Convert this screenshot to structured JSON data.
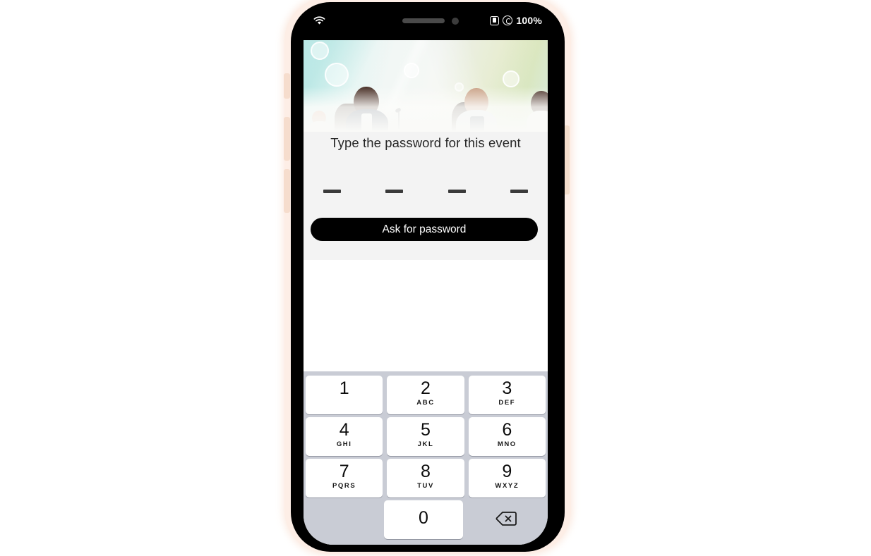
{
  "device": {
    "type": "smartphone-mockup",
    "frame_color": "#000000",
    "rim_color": "#fdeee6"
  },
  "statusbar": {
    "wifi_icon": "wifi-icon",
    "alarm_icon": "alarm-icon",
    "orientation_lock_icon": "orientation-lock-icon",
    "battery_percent": "100%"
  },
  "banner": {
    "alt": "conference-audience-banner",
    "gradient_from": "#96e2de",
    "gradient_to": "#dfe5a7"
  },
  "panel": {
    "title": "Type the password for this event",
    "password_length": 4,
    "password_dashes": [
      "—",
      "—",
      "—",
      "—"
    ],
    "ask_button_label": "Ask for password",
    "ask_button_color": "#000000",
    "background": "#f3f3f3"
  },
  "keypad": {
    "background": "#c9ccd5",
    "key_background": "#ffffff",
    "delete_icon": "backspace-icon",
    "rows": [
      [
        {
          "digit": "1",
          "letters": ""
        },
        {
          "digit": "2",
          "letters": "ABC"
        },
        {
          "digit": "3",
          "letters": "DEF"
        }
      ],
      [
        {
          "digit": "4",
          "letters": "GHI"
        },
        {
          "digit": "5",
          "letters": "JKL"
        },
        {
          "digit": "6",
          "letters": "MNO"
        }
      ],
      [
        {
          "digit": "7",
          "letters": "PQRS"
        },
        {
          "digit": "8",
          "letters": "TUV"
        },
        {
          "digit": "9",
          "letters": "WXYZ"
        }
      ]
    ],
    "zero_key": {
      "digit": "0",
      "letters": ""
    }
  }
}
